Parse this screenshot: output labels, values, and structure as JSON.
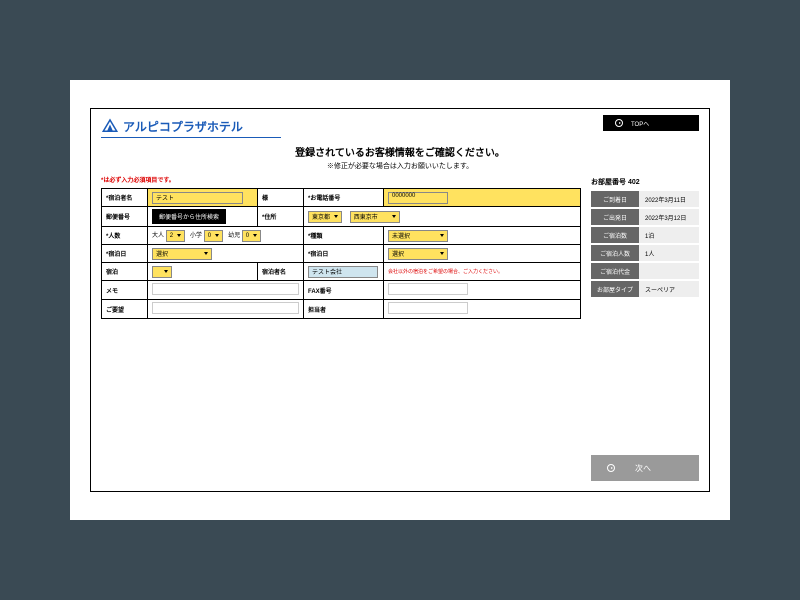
{
  "brand": "アルピコプラザホテル",
  "top_button": "TOPへ",
  "heading": "登録されているお客様情報をご確認ください。",
  "subheading": "※修正が必要な場合は入力お願いいたします。",
  "required_note": "*は必ず入力必須項目です。",
  "labels": {
    "name": "*宿泊者名",
    "postal": "郵便番号",
    "people": "*人数",
    "stay_from": "*宿泊日",
    "corp": "宿泊",
    "memo": "メモ",
    "request": "ご要望",
    "sample": "様",
    "phone": "*お電話番号",
    "pref": "*住所",
    "kind": "*種類",
    "stay_to": "*宿泊日",
    "corp_name": "宿泊者名",
    "fax": "FAX番号",
    "tantou": "担当者"
  },
  "values": {
    "name": "テスト",
    "phone": "0000000",
    "pref": "東京都",
    "city": "西東京市",
    "adult_label": "大人",
    "adult": "2",
    "childA_label": "小学",
    "childA": "0",
    "childB_label": "幼児",
    "childB": "0",
    "kind": "未選択",
    "date_from": "選択",
    "date_to": "選択",
    "corp_name": "テスト会社",
    "postal_btn": "郵便番号から住所検索"
  },
  "corp_hint": "会社以外の宿泊をご希望の場合、ご入力ください。",
  "side": {
    "title": "お部屋番号 402",
    "rows": [
      {
        "label": "ご到着日",
        "value": "2022年3月11日"
      },
      {
        "label": "ご出発日",
        "value": "2022年3月12日"
      },
      {
        "label": "ご宿泊数",
        "value": "1泊"
      },
      {
        "label": "ご宿泊人数",
        "value": "1人"
      },
      {
        "label": "ご宿泊代金",
        "value": ""
      },
      {
        "label": "お部屋タイプ",
        "value": "スーペリア"
      }
    ]
  },
  "next_button": "次へ"
}
